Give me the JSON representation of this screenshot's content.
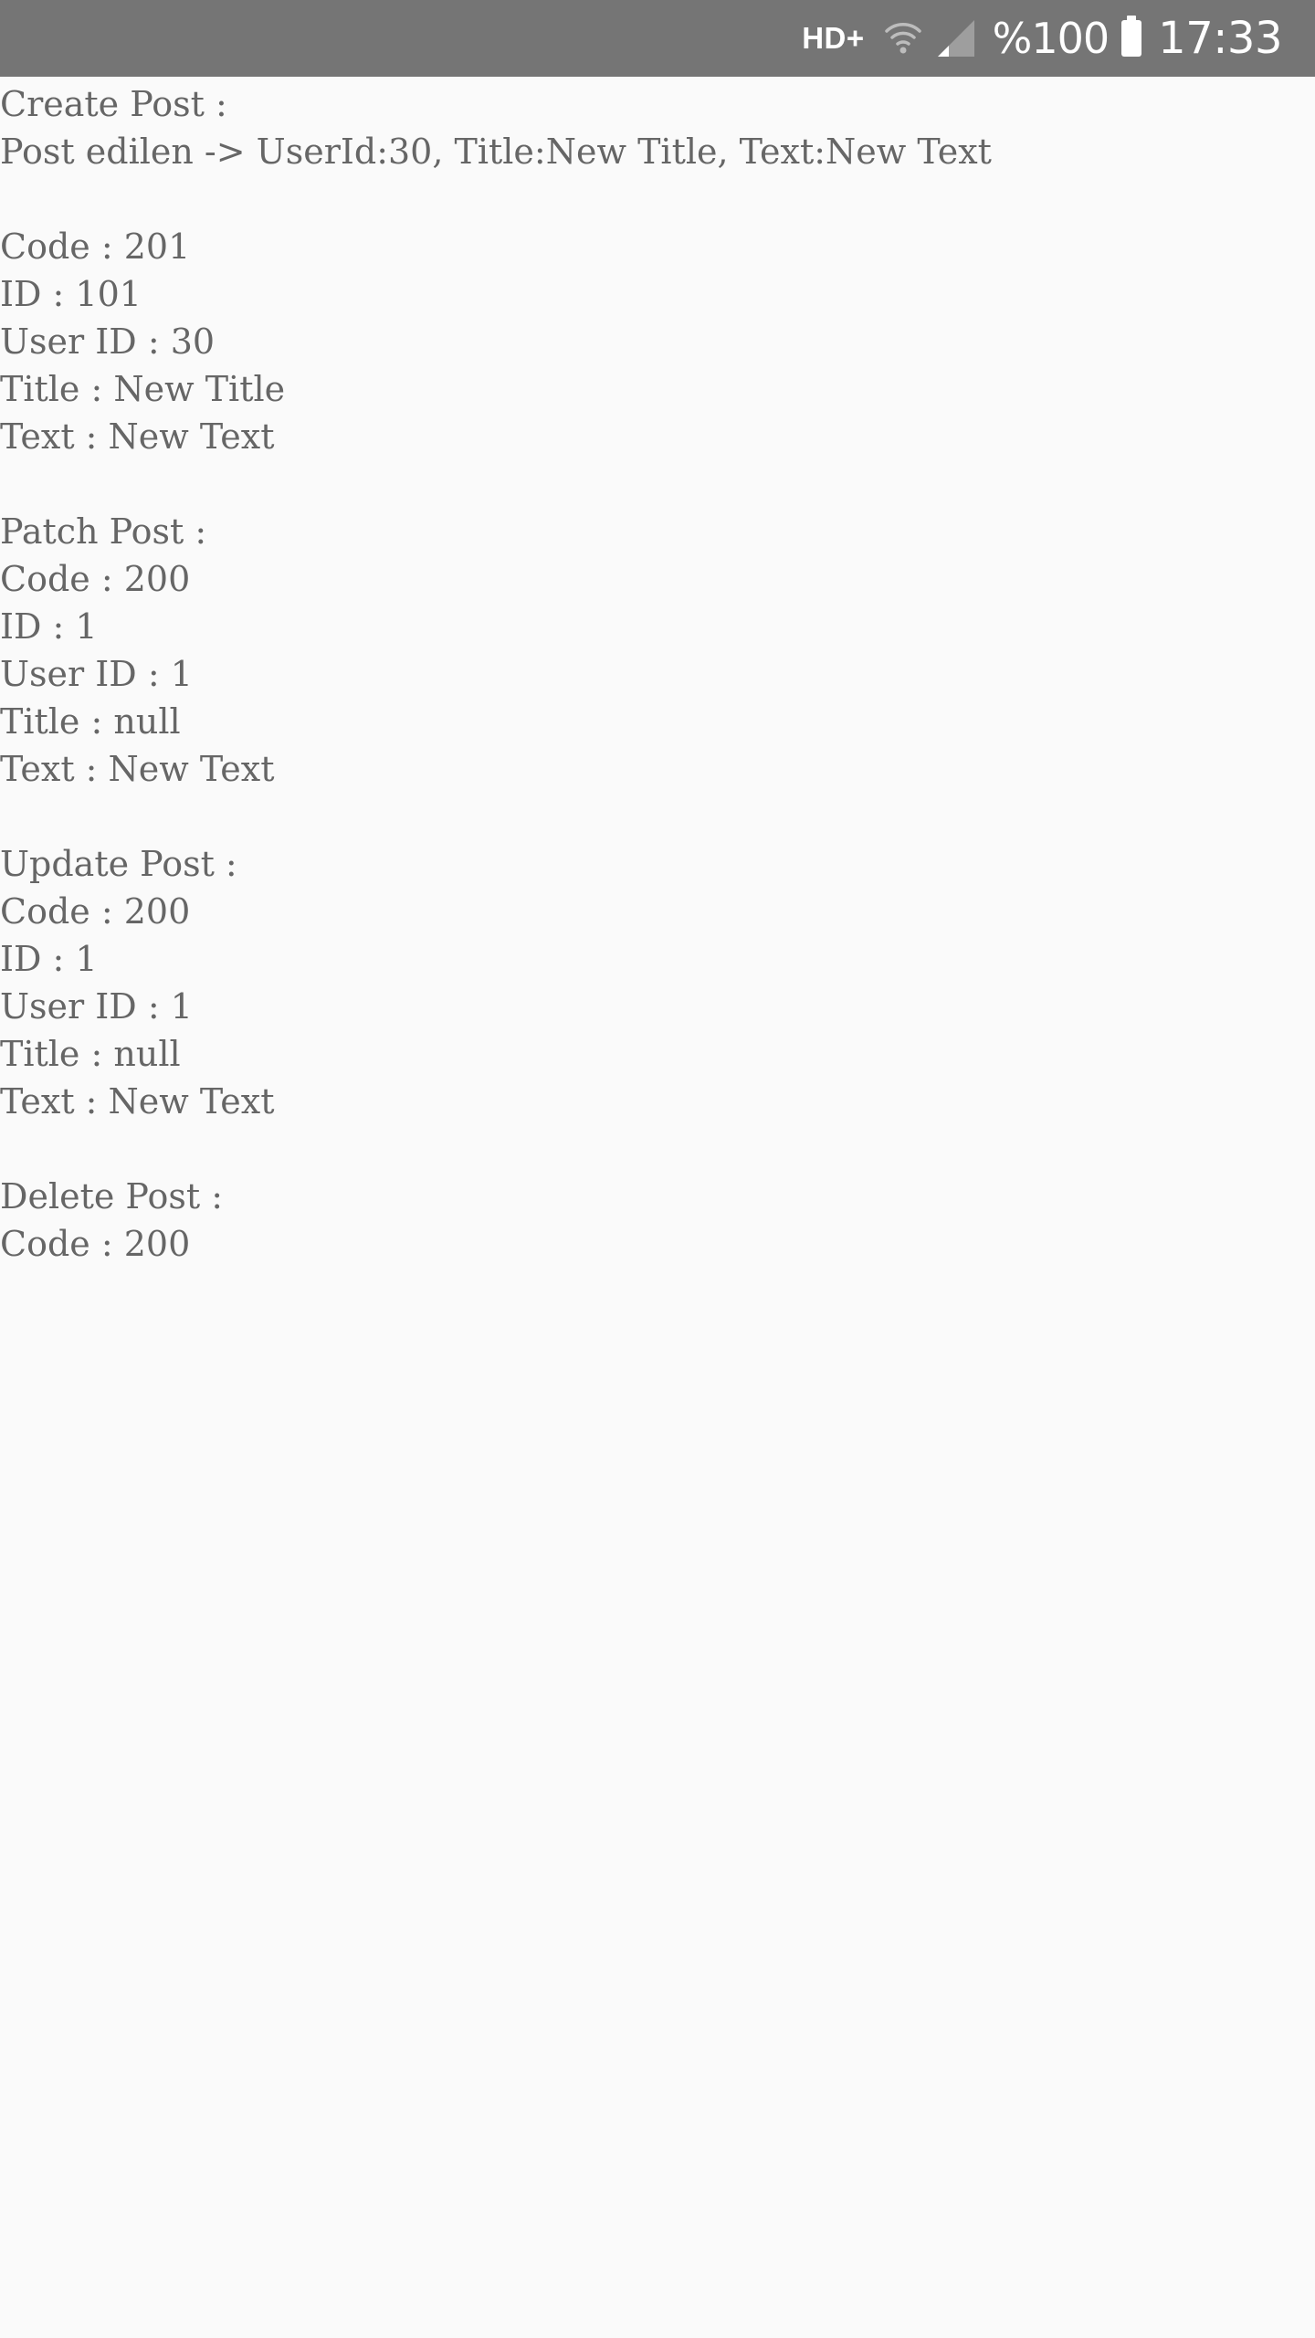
{
  "status_bar": {
    "network_label": "HD+",
    "battery_text": "%100",
    "time": "17:33"
  },
  "log": {
    "lines": [
      "Create Post :",
      "Post edilen -> UserId:30, Title:New Title, Text:New Text",
      "",
      "Code : 201",
      "ID : 101",
      "User ID : 30",
      "Title : New Title",
      "Text : New Text",
      "",
      "Patch Post :",
      "Code : 200",
      "ID : 1",
      "User ID : 1",
      "Title : null",
      "Text : New Text",
      "",
      "Update Post :",
      "Code : 200",
      "ID : 1",
      "User ID : 1",
      "Title : null",
      "Text : New Text",
      "",
      "Delete Post :",
      "Code : 200"
    ]
  },
  "colors": {
    "status_bar_bg": "#757575",
    "page_bg": "#fafafa",
    "text": "#666666"
  },
  "icons": [
    "wifi-icon",
    "signal-icon",
    "battery-icon"
  ]
}
